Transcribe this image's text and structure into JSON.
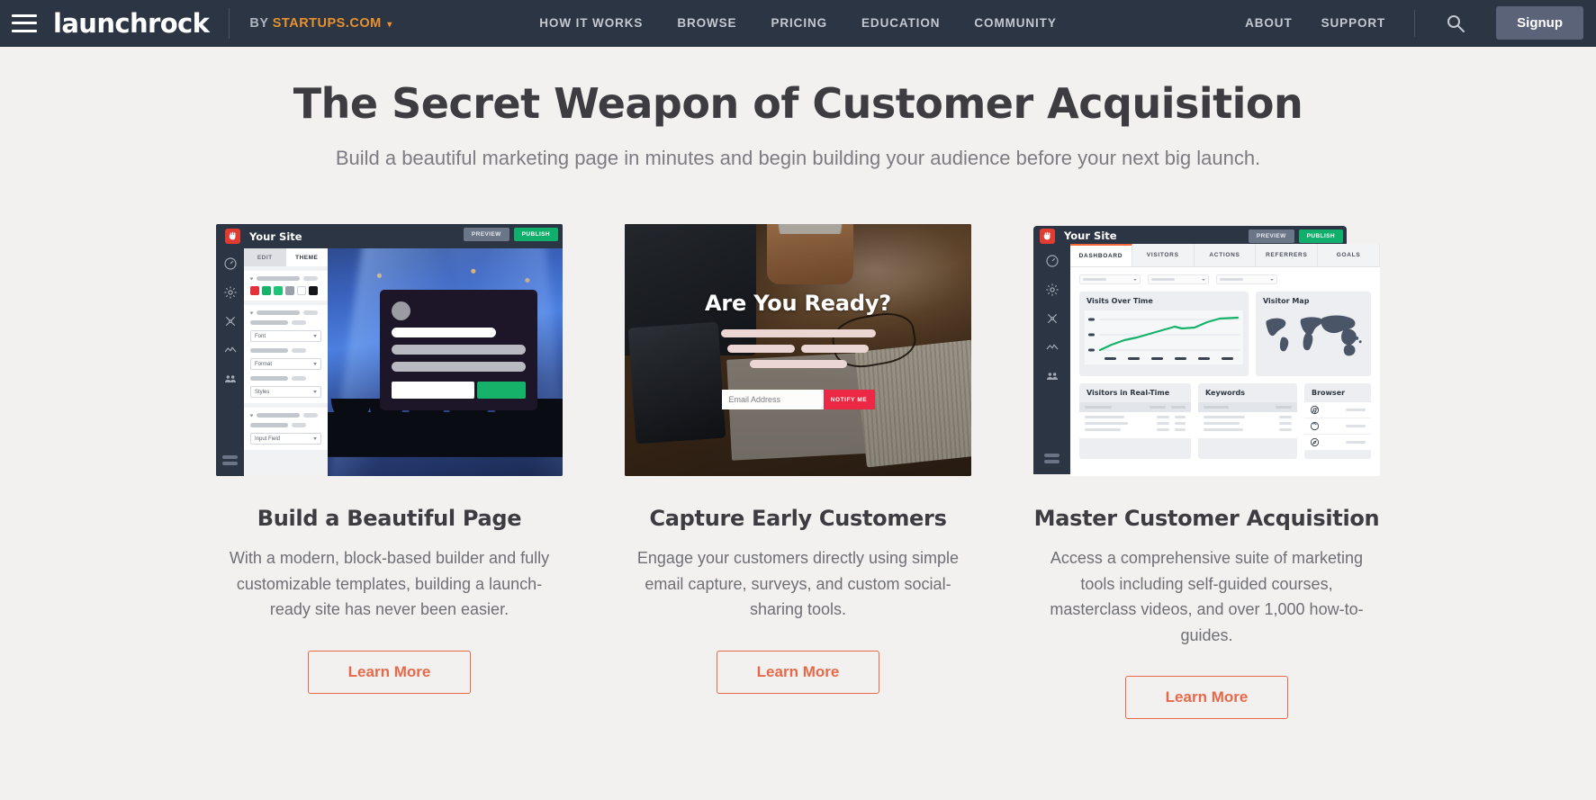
{
  "header": {
    "menu_icon": "hamburger-icon",
    "logo_text": "launchrock",
    "byline_by": "BY",
    "byline_brand": "STARTUPS.COM",
    "byline_caret": "▾",
    "nav": [
      {
        "label": "HOW IT WORKS"
      },
      {
        "label": "BROWSE"
      },
      {
        "label": "PRICING"
      },
      {
        "label": "EDUCATION"
      },
      {
        "label": "COMMUNITY"
      }
    ],
    "right_nav": [
      {
        "label": "ABOUT"
      },
      {
        "label": "SUPPORT"
      }
    ],
    "search_icon": "search-icon",
    "signup_label": "Signup",
    "bg_color": "#2C3543",
    "accent_color": "#E8922F"
  },
  "hero": {
    "title": "The Secret Weapon of Customer Acquisition",
    "subtitle": "Build a beautiful marketing page in minutes and begin building your audience before your next big launch."
  },
  "cards": [
    {
      "title": "Build a Beautiful Page",
      "body": "With a modern, block-based builder and fully customizable templates, building a launch-ready site has never been easier.",
      "cta": "Learn More"
    },
    {
      "title": "Capture Early Customers",
      "body": "Engage your customers directly using simple email capture, surveys, and custom social-sharing tools.",
      "cta": "Learn More"
    },
    {
      "title": "Master Customer Acquisition",
      "body": "Access a comprehensive suite of marketing tools including self-guided courses, masterclass videos, and over 1,000 how-to-guides.",
      "cta": "Learn More"
    }
  ],
  "mock_editor": {
    "site_title": "Your Site",
    "preview_label": "PREVIEW",
    "publish_label": "PUBLISH",
    "tab_edit": "EDIT",
    "tab_theme": "THEME",
    "select_font": "Font",
    "select_format": "Format",
    "select_styles": "Styles",
    "select_input": "Input Field",
    "swatches": [
      "#E2313A",
      "#17B26A",
      "#1FC47A",
      "#9AA0AA",
      "#FFFFFF",
      "#14161B"
    ],
    "rail_icons": [
      "speedometer-icon",
      "gear-icon",
      "tools-icon",
      "analytics-icon",
      "people-icon"
    ]
  },
  "mock_capture": {
    "headline": "Are You Ready?",
    "email_placeholder": "Email Address",
    "submit_label": "NOTIFY ME",
    "button_color": "#EC2945"
  },
  "mock_dashboard": {
    "site_title": "Your Site",
    "preview_label": "PREVIEW",
    "publish_label": "PUBLISH",
    "tabs": [
      "DASHBOARD",
      "VISITORS",
      "ACTIONS",
      "REFERRERS",
      "GOALS"
    ],
    "active_tab": "DASHBOARD",
    "panel_visits": "Visits Over Time",
    "panel_map": "Visitor Map",
    "panel_realtime": "Visitors in Real-Time",
    "panel_keywords": "Keywords",
    "panel_browser": "Browser",
    "line_color": "#17B26A",
    "accent_color": "#F0663D"
  }
}
